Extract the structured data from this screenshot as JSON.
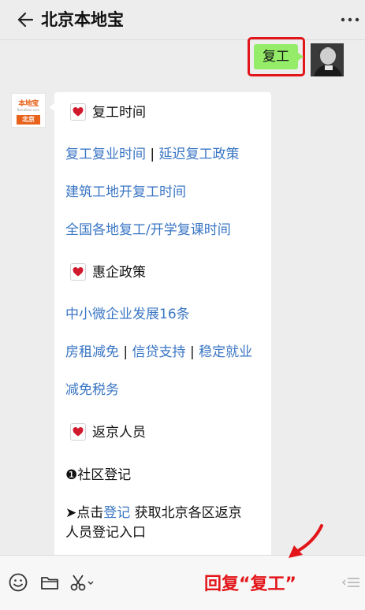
{
  "header": {
    "title": "北京本地宝"
  },
  "outgoing_message": {
    "text": "复工"
  },
  "bot": {
    "logo_top": "本地宝",
    "logo_url": "Bendibao.com",
    "logo_city": "北京"
  },
  "card": {
    "section1": {
      "title": "复工时间"
    },
    "links1": [
      {
        "text": "复工复业时间"
      },
      {
        "text": "延迟复工政策"
      }
    ],
    "link_construction": "建筑工地开复工时间",
    "link_nationwide": "全国各地复工/开学复课时间",
    "section2": {
      "title": "惠企政策"
    },
    "link_sme": "中小微企业发展16条",
    "links2": [
      {
        "text": "房租减免"
      },
      {
        "text": "信贷支持"
      },
      {
        "text": "稳定就业"
      }
    ],
    "link_tax": "减免税务",
    "section3": {
      "title": "返京人员"
    },
    "community": "❶社区登记",
    "click_prefix": "➤点击",
    "click_link": "登记",
    "click_suffix": " 获取北京各区返京",
    "click_line2": "人员登记入口",
    "separator": "|"
  },
  "annotation": {
    "text": "回复“复工”"
  },
  "colors": {
    "link": "#3a76c4",
    "annotation_red": "#e2151a",
    "bubble_green": "#95ec69",
    "brand_orange": "#e8621b"
  },
  "icons": [
    "back-arrow-icon",
    "more-icon",
    "heart-icon",
    "emoji-icon",
    "folder-icon",
    "scissors-icon",
    "list-icon",
    "arrow-icon"
  ]
}
